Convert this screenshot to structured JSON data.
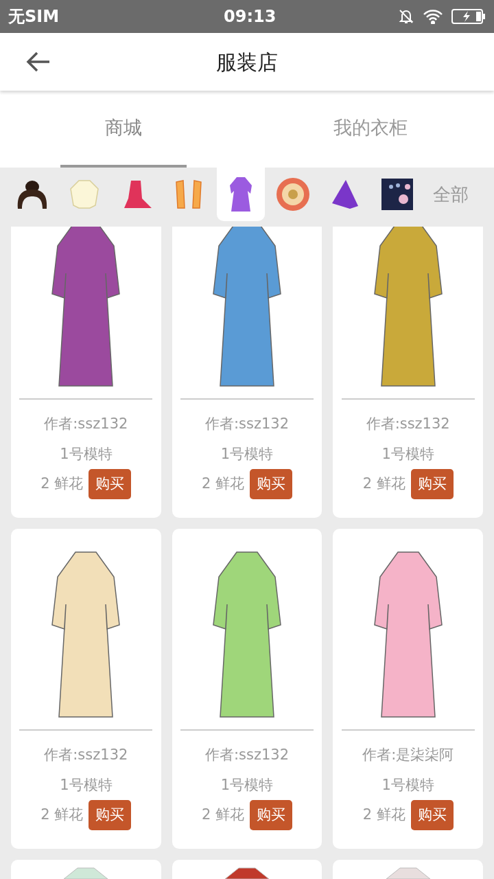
{
  "status_bar": {
    "carrier": "无SIM",
    "time": "09:13"
  },
  "header": {
    "title": "服装店"
  },
  "tabs": [
    {
      "label": "商城",
      "selected": true
    },
    {
      "label": "我的衣柜",
      "selected": false
    }
  ],
  "categories": [
    {
      "kind": "hair",
      "selected": false
    },
    {
      "kind": "top",
      "selected": false
    },
    {
      "kind": "skirt",
      "selected": false
    },
    {
      "kind": "sleeves",
      "selected": false
    },
    {
      "kind": "robe",
      "selected": true
    },
    {
      "kind": "flower",
      "selected": false
    },
    {
      "kind": "scarf",
      "selected": false
    },
    {
      "kind": "backdrop",
      "selected": false
    },
    {
      "kind": "text",
      "label": "全部",
      "selected": false
    }
  ],
  "items": [
    {
      "color": "#9b4a9e",
      "author": "作者:ssz132",
      "model": "1号模特",
      "price": "2 鲜花",
      "button": "购买"
    },
    {
      "color": "#5a9bd5",
      "author": "作者:ssz132",
      "model": "1号模特",
      "price": "2 鲜花",
      "button": "购买"
    },
    {
      "color": "#c9a93a",
      "author": "作者:ssz132",
      "model": "1号模特",
      "price": "2 鲜花",
      "button": "购买"
    },
    {
      "color": "#f2dfb8",
      "author": "作者:ssz132",
      "model": "1号模特",
      "price": "2 鲜花",
      "button": "购买"
    },
    {
      "color": "#9fd67a",
      "author": "作者:ssz132",
      "model": "1号模特",
      "price": "2 鲜花",
      "button": "购买"
    },
    {
      "color": "#f5b3c8",
      "author": "作者:是柒柒阿",
      "model": "1号模特",
      "price": "2 鲜花",
      "button": "购买"
    },
    {
      "color": "#cfe8d8"
    },
    {
      "color": "#c0392b"
    },
    {
      "color": "#e8dede"
    }
  ]
}
